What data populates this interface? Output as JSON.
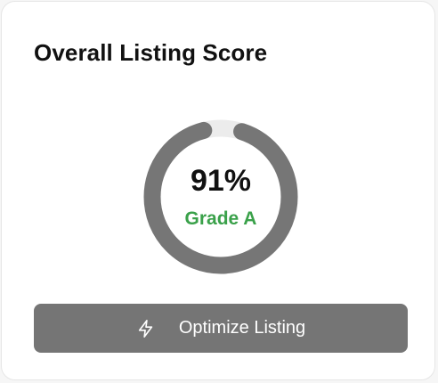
{
  "card": {
    "title": "Overall Listing Score"
  },
  "score": {
    "value_text": "91%",
    "fraction": 0.91,
    "grade_text": "Grade A"
  },
  "button": {
    "label": "Optimize Listing",
    "icon": "lightning-bolt-icon"
  },
  "colors": {
    "progress": "#767676",
    "track": "#ececec",
    "grade": "#3aa14a",
    "button": "#757575"
  }
}
